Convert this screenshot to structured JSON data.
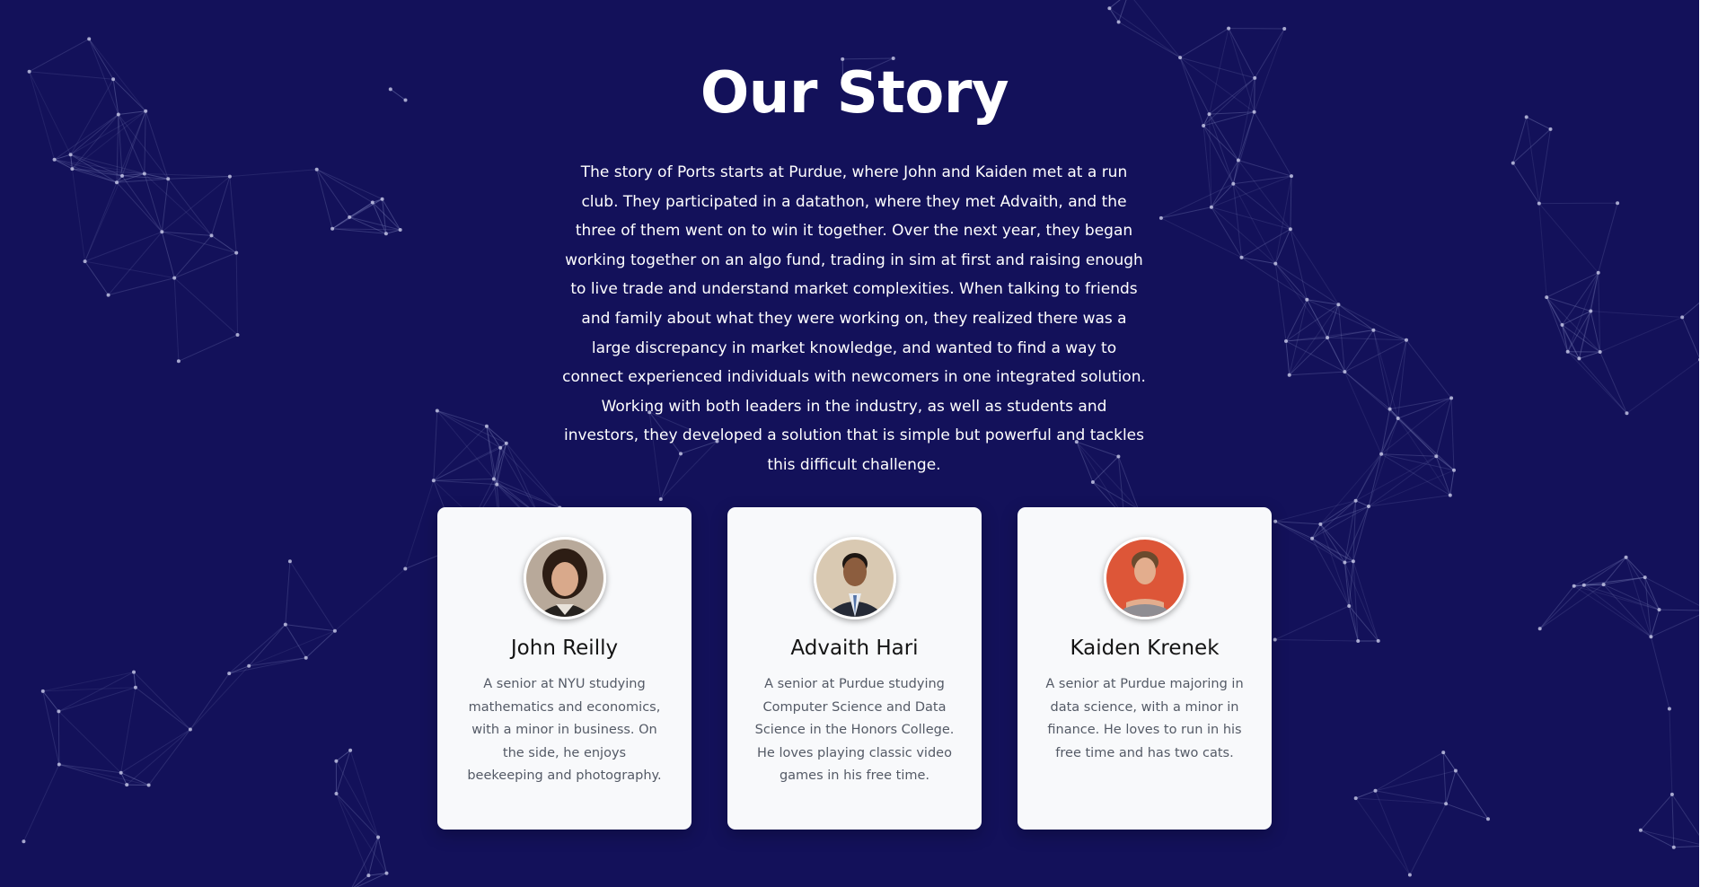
{
  "section": {
    "title": "Our Story",
    "story": "The story of Ports starts at Purdue, where John and Kaiden met at a run club. They participated in a datathon, where they met Advaith, and the three of them went on to win it together. Over the next year, they began working together on an algo fund, trading in sim at first and raising enough to live trade and understand market complexities. When talking to friends and family about what they were working on, they realized there was a large discrepancy in market knowledge, and wanted to find a way to connect experienced individuals with newcomers in one integrated solution. Working with both leaders in the industry, as well as students and investors, they developed a solution that is simple but powerful and tackles this difficult challenge."
  },
  "team": [
    {
      "name": "John Reilly",
      "bio": "A senior at NYU studying mathematics and economics, with a minor in business. On the side, he enjoys beekeeping and photography."
    },
    {
      "name": "Advaith Hari",
      "bio": "A senior at Purdue studying Computer Science and Data Science in the Honors College. He loves playing classic video games in his free time."
    },
    {
      "name": "Kaiden Krenek",
      "bio": "A senior at Purdue majoring in data science, with a minor in finance. He loves to run in his free time and has two cats."
    }
  ],
  "colors": {
    "background": "#13115a",
    "card": "#f8f9fb",
    "heading": "#ffffff",
    "name": "#141414",
    "bio": "#545a66",
    "network_line": "#7a7fb8",
    "network_node": "#c9cbe8"
  }
}
